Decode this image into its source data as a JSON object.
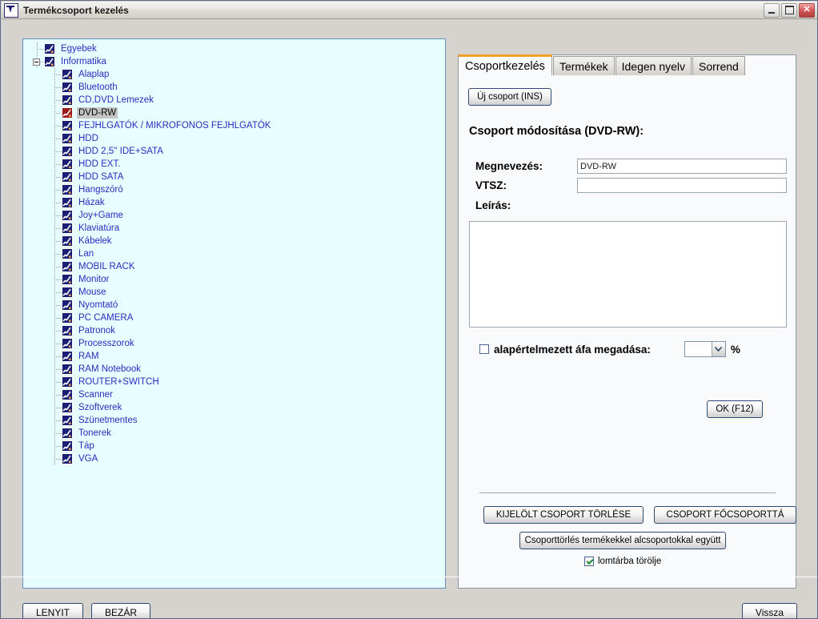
{
  "window": {
    "title": "Termékcsoport kezelés",
    "icon": "app-logo-icon",
    "minimize_label": "",
    "maximize_label": "",
    "close_label": "✕"
  },
  "tree": {
    "nodes": [
      {
        "label": "Egyebek",
        "level": 0,
        "icon_color": "#1b1f73",
        "selected": false,
        "expander": false
      },
      {
        "label": "Informatika",
        "level": 0,
        "icon_color": "#1b1f73",
        "selected": false,
        "expander": true
      },
      {
        "label": "Alaplap",
        "level": 1,
        "icon_color": "#1b1f73",
        "selected": false,
        "expander": false
      },
      {
        "label": "Bluetooth",
        "level": 1,
        "icon_color": "#1b1f73",
        "selected": false,
        "expander": false
      },
      {
        "label": "CD,DVD Lemezek",
        "level": 1,
        "icon_color": "#1b1f73",
        "selected": false,
        "expander": false
      },
      {
        "label": "DVD-RW",
        "level": 1,
        "icon_color": "#9b1b1b",
        "selected": true,
        "expander": false
      },
      {
        "label": "FEJHLGATÓK / MIKROFONOS FEJHLGATÓK",
        "level": 1,
        "icon_color": "#1b1f73",
        "selected": false,
        "expander": false
      },
      {
        "label": "HDD",
        "level": 1,
        "icon_color": "#1b1f73",
        "selected": false,
        "expander": false
      },
      {
        "label": "HDD 2,5'' IDE+SATA",
        "level": 1,
        "icon_color": "#1b1f73",
        "selected": false,
        "expander": false
      },
      {
        "label": "HDD EXT.",
        "level": 1,
        "icon_color": "#1b1f73",
        "selected": false,
        "expander": false
      },
      {
        "label": "HDD SATA",
        "level": 1,
        "icon_color": "#1b1f73",
        "selected": false,
        "expander": false
      },
      {
        "label": "Hangszóró",
        "level": 1,
        "icon_color": "#1b1f73",
        "selected": false,
        "expander": false
      },
      {
        "label": "Házak",
        "level": 1,
        "icon_color": "#1b1f73",
        "selected": false,
        "expander": false
      },
      {
        "label": "Joy+Game",
        "level": 1,
        "icon_color": "#1b1f73",
        "selected": false,
        "expander": false
      },
      {
        "label": "Klaviatúra",
        "level": 1,
        "icon_color": "#1b1f73",
        "selected": false,
        "expander": false
      },
      {
        "label": "Kábelek",
        "level": 1,
        "icon_color": "#1b1f73",
        "selected": false,
        "expander": false
      },
      {
        "label": "Lan",
        "level": 1,
        "icon_color": "#1b1f73",
        "selected": false,
        "expander": false
      },
      {
        "label": "MOBIL RACK",
        "level": 1,
        "icon_color": "#1b1f73",
        "selected": false,
        "expander": false
      },
      {
        "label": "Monitor",
        "level": 1,
        "icon_color": "#1b1f73",
        "selected": false,
        "expander": false
      },
      {
        "label": "Mouse",
        "level": 1,
        "icon_color": "#1b1f73",
        "selected": false,
        "expander": false
      },
      {
        "label": "Nyomtató",
        "level": 1,
        "icon_color": "#1b1f73",
        "selected": false,
        "expander": false
      },
      {
        "label": "PC CAMERA",
        "level": 1,
        "icon_color": "#1b1f73",
        "selected": false,
        "expander": false
      },
      {
        "label": "Patronok",
        "level": 1,
        "icon_color": "#1b1f73",
        "selected": false,
        "expander": false
      },
      {
        "label": "Processzorok",
        "level": 1,
        "icon_color": "#1b1f73",
        "selected": false,
        "expander": false
      },
      {
        "label": "RAM",
        "level": 1,
        "icon_color": "#1b1f73",
        "selected": false,
        "expander": false
      },
      {
        "label": "RAM Notebook",
        "level": 1,
        "icon_color": "#1b1f73",
        "selected": false,
        "expander": false
      },
      {
        "label": "ROUTER+SWITCH",
        "level": 1,
        "icon_color": "#1b1f73",
        "selected": false,
        "expander": false
      },
      {
        "label": "Scanner",
        "level": 1,
        "icon_color": "#1b1f73",
        "selected": false,
        "expander": false
      },
      {
        "label": "Szoftverek",
        "level": 1,
        "icon_color": "#1b1f73",
        "selected": false,
        "expander": false
      },
      {
        "label": "Szünetmentes",
        "level": 1,
        "icon_color": "#1b1f73",
        "selected": false,
        "expander": false
      },
      {
        "label": "Tonerek",
        "level": 1,
        "icon_color": "#1b1f73",
        "selected": false,
        "expander": false
      },
      {
        "label": "Táp",
        "level": 1,
        "icon_color": "#1b1f73",
        "selected": false,
        "expander": false
      },
      {
        "label": "VGA",
        "level": 1,
        "icon_color": "#1b1f73",
        "selected": false,
        "expander": false
      }
    ]
  },
  "tabs": [
    {
      "label": "Csoportkezelés",
      "active": true
    },
    {
      "label": "Termékek",
      "active": false
    },
    {
      "label": "Idegen nyelv",
      "active": false
    },
    {
      "label": "Sorrend",
      "active": false
    }
  ],
  "panel": {
    "new_group_button": "Új csoport (INS)",
    "section_title": "Csoport módosítása (DVD-RW):",
    "fields": {
      "name_label": "Megnevezés:",
      "name_value": "DVD-RW",
      "name_placeholder": "",
      "vtsz_label": "VTSZ:",
      "vtsz_value": "",
      "vtsz_placeholder": "",
      "description_label": "Leírás:",
      "description_value": "",
      "description_placeholder": ""
    },
    "vat": {
      "checkbox_label": "alapértelmezett áfa megadása:",
      "checked": false,
      "value": "",
      "suffix": "%"
    },
    "ok_button": "OK (F12)",
    "delete_selected_button": "KIJELÖLT CSOPORT TÖRLÉSE",
    "make_main_button": "CSOPORT FŐCSOPORTTÁ",
    "delete_with_products_button": "Csoporttörlés termékekkel alcsoportokkal együtt",
    "trash_checkbox_label": "lomtárba törölje",
    "trash_checked": true
  },
  "footer": {
    "expand_button": "LENYIT",
    "close_button": "BEZÁR",
    "back_button": "Vissza"
  },
  "colors": {
    "accent_tab": "#f0a027",
    "tree_bg": "#e6feff",
    "tree_text": "#2b2bbf",
    "selected_bg": "#c4c4c4",
    "panel_bg": "#f9fafc",
    "window_bg": "#d6d3ce",
    "icon_normal": "#1b1f73",
    "icon_selected": "#9b1b1b",
    "check_green": "#1d8a2e"
  }
}
